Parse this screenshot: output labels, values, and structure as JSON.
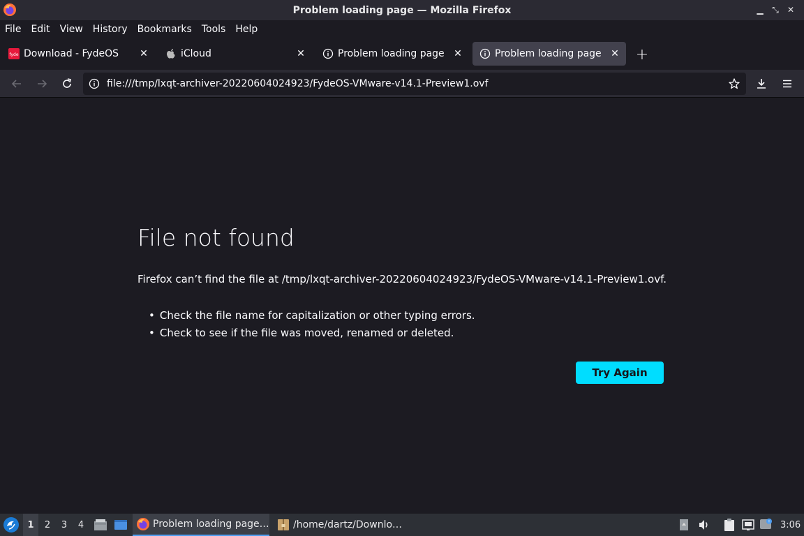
{
  "window": {
    "title": "Problem loading page — Mozilla Firefox"
  },
  "menu": [
    "File",
    "Edit",
    "View",
    "History",
    "Bookmarks",
    "Tools",
    "Help"
  ],
  "tabs": [
    {
      "label": "Download - FydeOS",
      "icon": "fydeos-favicon",
      "active": false
    },
    {
      "label": "iCloud",
      "icon": "apple-favicon",
      "active": false
    },
    {
      "label": "Problem loading page",
      "icon": "info-icon",
      "active": false
    },
    {
      "label": "Problem loading page",
      "icon": "info-icon",
      "active": true
    }
  ],
  "urlbar": {
    "url": "file:///tmp/lxqt-archiver-20220604024923/FydeOS-VMware-v14.1-Preview1.ovf"
  },
  "error": {
    "title": "File not found",
    "description": "Firefox can’t find the file at /tmp/lxqt-archiver-20220604024923/FydeOS-VMware-v14.1-Preview1.ovf.",
    "tips": [
      "Check the file name for capitalization or other typing errors.",
      "Check to see if the file was moved, renamed or deleted."
    ],
    "button": "Try Again"
  },
  "taskbar": {
    "desktops": [
      "1",
      "2",
      "3",
      "4"
    ],
    "tasks": [
      {
        "label": "Problem loading page…",
        "icon": "firefox-icon",
        "active": true
      },
      {
        "label": "/home/dartz/Downlo…",
        "icon": "archive-icon",
        "active": false
      }
    ],
    "clock": "3:06"
  },
  "colors": {
    "accent": "#00ddff",
    "background": "#1c1b22",
    "toolbar": "#2b2a33",
    "active_tab": "#42414d"
  }
}
